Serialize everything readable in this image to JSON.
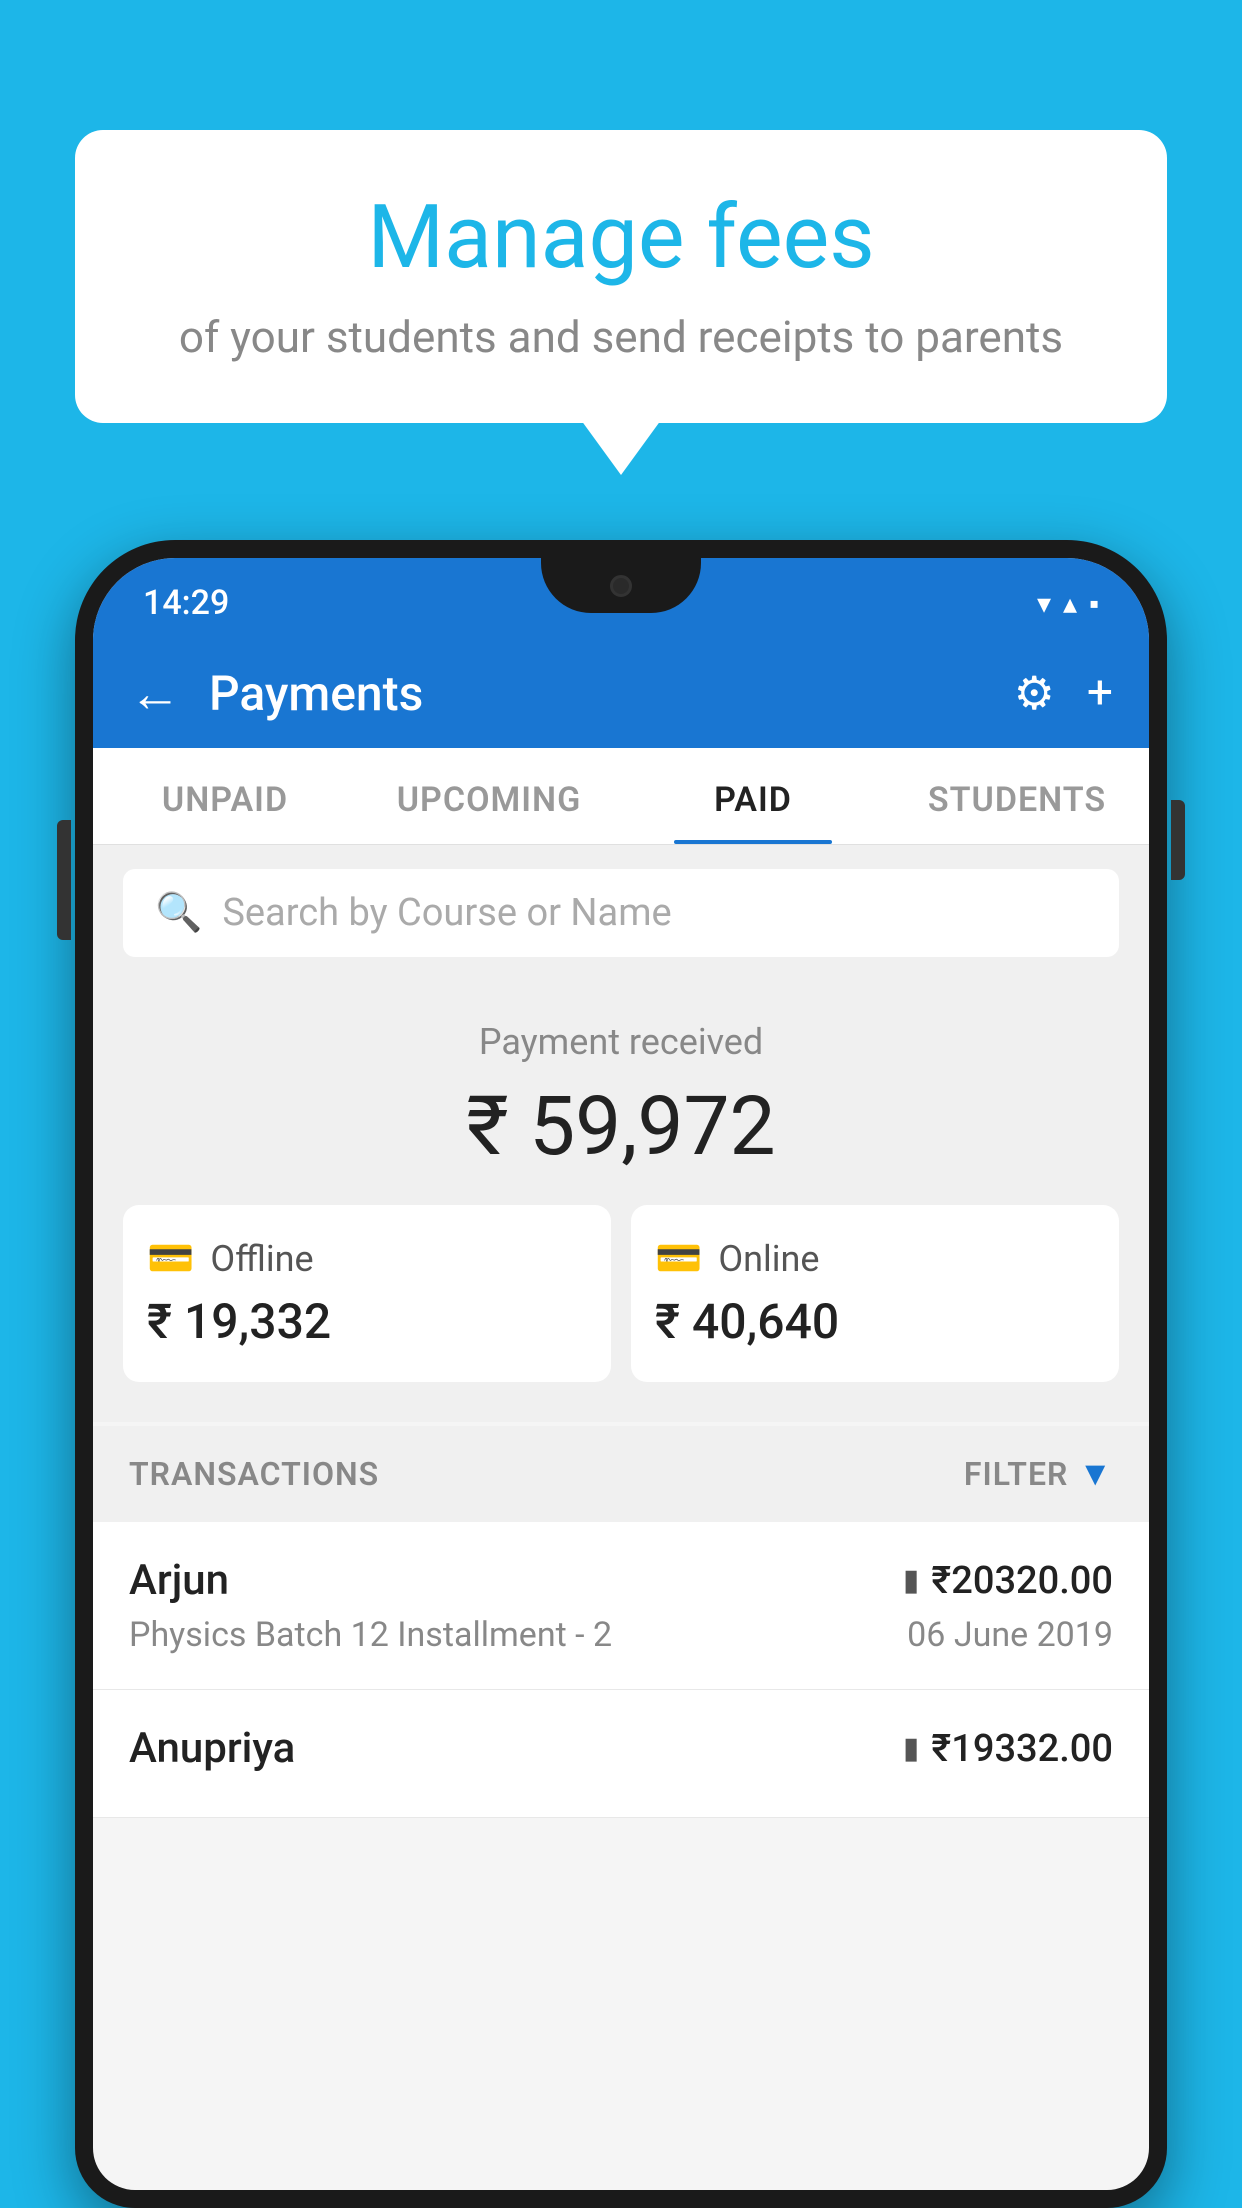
{
  "background_color": "#1DB6E8",
  "speech_bubble": {
    "title": "Manage fees",
    "subtitle": "of your students and send receipts to parents"
  },
  "status_bar": {
    "time": "14:29",
    "wifi_icon": "▼",
    "signal_icon": "▲",
    "battery_icon": "▪"
  },
  "app_bar": {
    "title": "Payments",
    "back_label": "←",
    "settings_label": "⚙",
    "add_label": "+"
  },
  "tabs": [
    {
      "label": "UNPAID",
      "active": false
    },
    {
      "label": "UPCOMING",
      "active": false
    },
    {
      "label": "PAID",
      "active": true
    },
    {
      "label": "STUDENTS",
      "active": false
    }
  ],
  "search": {
    "placeholder": "Search by Course or Name"
  },
  "payment": {
    "label": "Payment received",
    "amount": "₹ 59,972",
    "offline": {
      "type": "Offline",
      "amount": "₹ 19,332"
    },
    "online": {
      "type": "Online",
      "amount": "₹ 40,640"
    }
  },
  "transactions": {
    "header_label": "TRANSACTIONS",
    "filter_label": "FILTER",
    "items": [
      {
        "name": "Arjun",
        "amount": "₹20320.00",
        "course": "Physics Batch 12 Installment - 2",
        "date": "06 June 2019",
        "payment_type": "online"
      },
      {
        "name": "Anupriya",
        "amount": "₹19332.00",
        "course": "",
        "date": "",
        "payment_type": "offline"
      }
    ]
  }
}
